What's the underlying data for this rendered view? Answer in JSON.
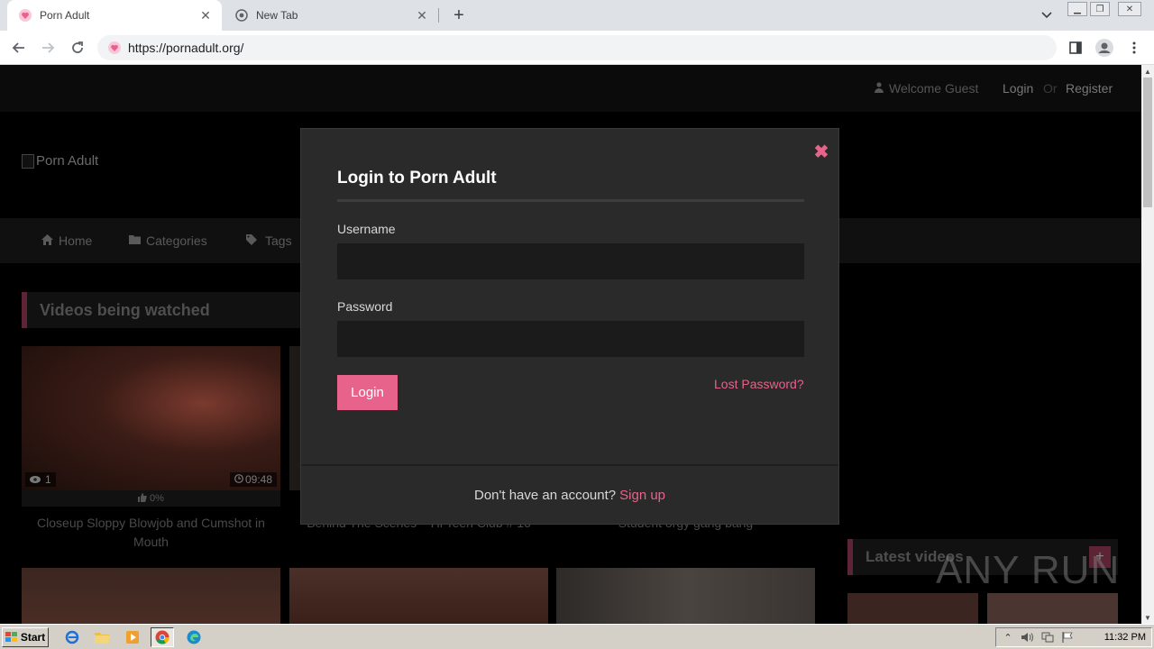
{
  "browser": {
    "tabs": [
      {
        "title": "Porn Adult",
        "active": true
      },
      {
        "title": "New Tab",
        "active": false
      }
    ],
    "url": "https://pornadult.org/"
  },
  "page": {
    "topbar": {
      "welcome": "Welcome Guest",
      "login": "Login",
      "or": "Or",
      "register": "Register"
    },
    "logo_alt": "Porn Adult",
    "nav": [
      {
        "label": "Home",
        "icon": "home-icon"
      },
      {
        "label": "Categories",
        "icon": "folder-icon"
      },
      {
        "label": "Tags",
        "icon": "tags-icon"
      }
    ],
    "section_title": "Videos being watched",
    "videos": [
      {
        "views": "1",
        "duration": "09:48",
        "rating": "0%",
        "title": "Closeup Sloppy Blowjob and Cumshot in Mouth"
      },
      {
        "title": "Behind The Scenes – Hi Teen Club # 16"
      },
      {
        "title": "Student orgy gang bang"
      }
    ],
    "sidebar_title": "Latest videos",
    "sidebar_plus": "+",
    "watermark": "ANY RUN"
  },
  "modal": {
    "title": "Login to Porn Adult",
    "username_label": "Username",
    "username_value": "",
    "password_label": "Password",
    "password_value": "",
    "login_button": "Login",
    "lost_password": "Lost Password?",
    "footer_question": "Don't have an account?",
    "signup": "Sign up",
    "close_symbol": "✖"
  },
  "taskbar": {
    "start": "Start",
    "clock": "11:32 PM"
  },
  "colors": {
    "accent": "#e8638c",
    "modal_bg": "#2a2a2a",
    "input_bg": "#1b1b1b"
  }
}
